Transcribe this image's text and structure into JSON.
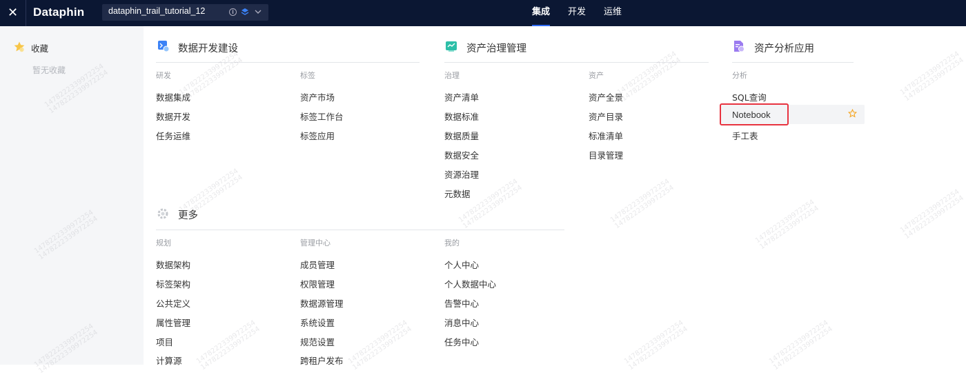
{
  "topbar": {
    "close_icon": "close-icon",
    "logo": "Dataphin",
    "project": {
      "name": "dataphin_trail_tutorial_12",
      "info_icon": "info-circle-icon",
      "env_icon": "environment-layer-icon",
      "chevron_icon": "chevron-down-icon"
    },
    "nav": [
      "集成",
      "开发",
      "运维"
    ],
    "active_nav": "集成",
    "colors": {
      "background": "#0b1733",
      "accent": "#2f6cf6"
    }
  },
  "sidebar": {
    "title": "收藏",
    "icon": "star-filled-icon",
    "empty_text": "暂无收藏"
  },
  "sections": {
    "dev": {
      "title": "数据开发建设",
      "icon": "data-dev-icon",
      "groups": [
        {
          "label": "研发",
          "items": [
            "数据集成",
            "数据开发",
            "任务运维"
          ]
        },
        {
          "label": "标签",
          "items": [
            "资产市场",
            "标签工作台",
            "标签应用"
          ]
        }
      ]
    },
    "governance": {
      "title": "资产治理管理",
      "icon": "asset-governance-icon",
      "groups": [
        {
          "label": "治理",
          "items": [
            "资产清单",
            "数据标准",
            "数据质量",
            "数据安全",
            "资源治理",
            "元数据"
          ]
        },
        {
          "label": "资产",
          "items": [
            "资产全景",
            "资产目录",
            "标准清单",
            "目录管理"
          ]
        }
      ]
    },
    "analysis": {
      "title": "资产分析应用",
      "icon": "asset-analysis-icon",
      "groups": [
        {
          "label": "分析",
          "items": [
            "SQL查询",
            "Notebook",
            "手工表"
          ]
        }
      ],
      "highlighted_item": "Notebook",
      "highlight_star_icon": "star-outline-icon",
      "colors": {
        "highlight_border": "#e8323f",
        "star": "#f5a623"
      }
    },
    "more": {
      "title": "更多",
      "icon": "gear-icon",
      "groups": [
        {
          "label": "规划",
          "items": [
            "数据架构",
            "标签架构",
            "公共定义",
            "属性管理",
            "项目",
            "计算源"
          ]
        },
        {
          "label": "管理中心",
          "items": [
            "成员管理",
            "权限管理",
            "数据源管理",
            "系统设置",
            "规范设置",
            "跨租户发布"
          ]
        },
        {
          "label": "我的",
          "items": [
            "个人中心",
            "个人数据中心",
            "告警中心",
            "消息中心",
            "任务中心"
          ]
        }
      ]
    }
  },
  "watermark": "1478222339972254"
}
